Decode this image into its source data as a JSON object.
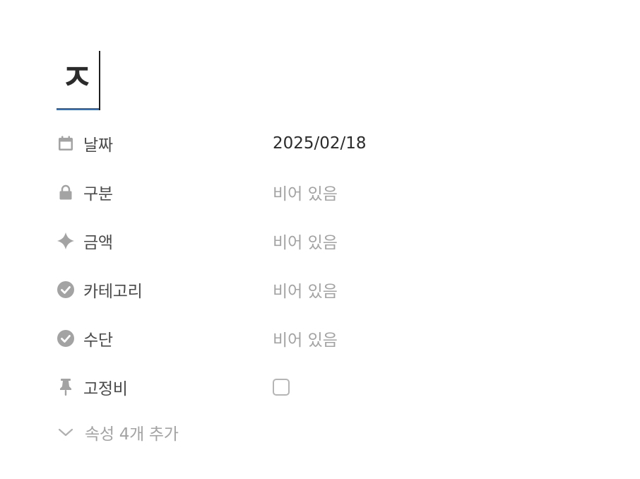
{
  "title": {
    "text": "ㅈ"
  },
  "properties": [
    {
      "icon": "calendar-icon",
      "label": "날짜",
      "value": "2025/02/18",
      "empty": false
    },
    {
      "icon": "lock-icon",
      "label": "구분",
      "value": "비어 있음",
      "empty": true
    },
    {
      "icon": "diamond-icon",
      "label": "금액",
      "value": "비어 있음",
      "empty": true
    },
    {
      "icon": "check-circle-icon",
      "label": "카테고리",
      "value": "비어 있음",
      "empty": true
    },
    {
      "icon": "check-circle-icon",
      "label": "수단",
      "value": "비어 있음",
      "empty": true
    },
    {
      "icon": "pin-icon",
      "label": "고정비",
      "checked": false
    }
  ],
  "more": {
    "icon": "chevron-down-icon",
    "label": "속성 4개 추가"
  },
  "colors": {
    "icon_gray": "#a3a3a3",
    "accent_underline": "#2f6fbf",
    "value_text": "#2b2b2b",
    "placeholder_text": "#a3a3a3"
  }
}
